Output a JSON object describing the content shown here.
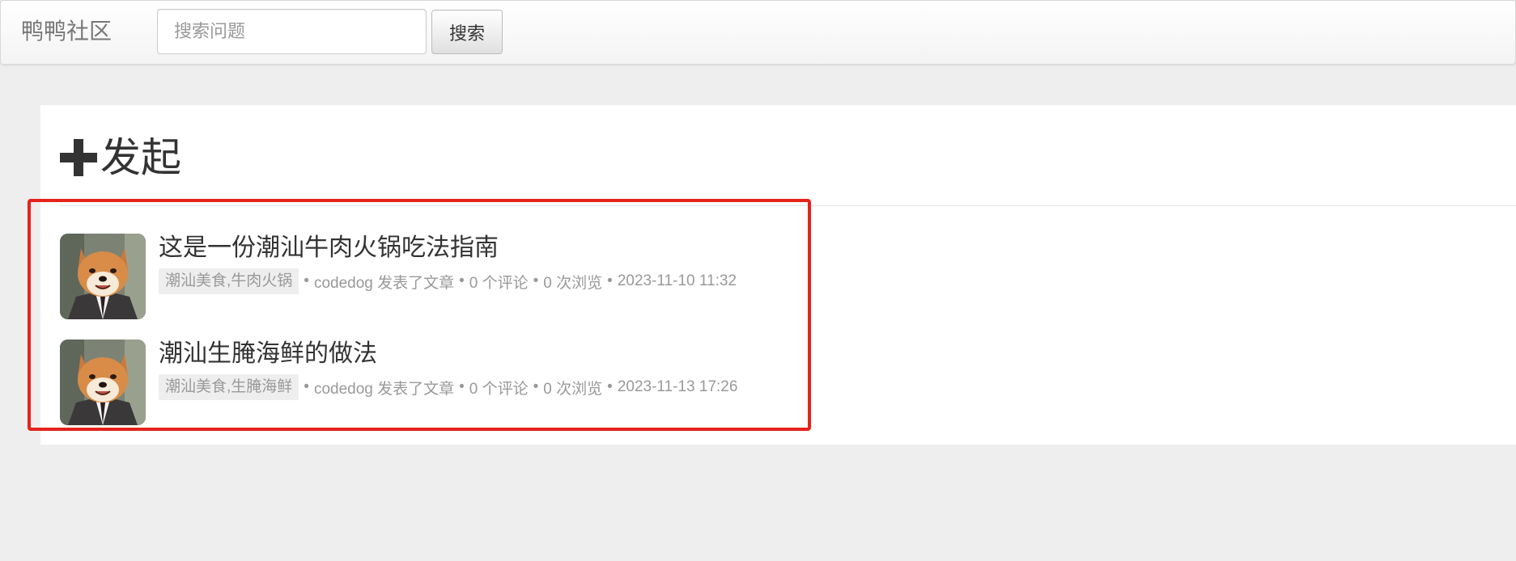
{
  "navbar": {
    "brand": "鸭鸭社区",
    "search_placeholder": "搜索问题",
    "search_button": "搜索"
  },
  "main": {
    "create_label": "发起",
    "posts": [
      {
        "title": "这是一份潮汕牛肉火锅吃法指南",
        "tags": "潮汕美食,牛肉火锅",
        "action": "codedog 发表了文章",
        "comments": "0 个评论",
        "views": "0 次浏览",
        "timestamp": "2023-11-10 11:32"
      },
      {
        "title": "潮汕生腌海鲜的做法",
        "tags": "潮汕美食,生腌海鲜",
        "action": "codedog 发表了文章",
        "comments": "0 个评论",
        "views": "0 次浏览",
        "timestamp": "2023-11-13 17:26"
      }
    ]
  },
  "colors": {
    "highlight": "#e5231b",
    "background": "#eeeeee"
  },
  "icons": {
    "create": "plus-icon",
    "avatar": "shiba-dog-avatar"
  }
}
